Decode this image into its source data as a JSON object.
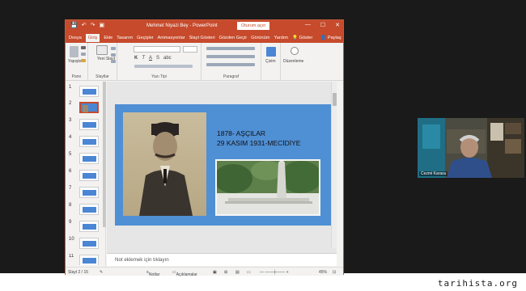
{
  "window": {
    "title": "Mehmet Niyazi Bey - PowerPoint",
    "signin": "Oturum açın",
    "controls": {
      "minimize": "—",
      "maximize": "☐",
      "close": "✕"
    }
  },
  "ribbon_tabs": [
    "Dosya",
    "Giriş",
    "Ekle",
    "Tasarım",
    "Geçişler",
    "Animasyonlar",
    "Slayt Gösteri",
    "Gözden Geçir",
    "Görünüm",
    "Yardım"
  ],
  "ribbon_right": {
    "tellme": "Göster",
    "share": "Paylaş"
  },
  "ribbon_groups": {
    "clipboard": {
      "label": "Pano",
      "paste": "Yapıştır"
    },
    "slides": {
      "label": "Slaytlar",
      "new_slide": "Yeni Slayt"
    },
    "font": {
      "label": "Yazı Tipi",
      "bold": "K",
      "italic": "T",
      "underline": "A",
      "strike": "S",
      "shadow": "abc"
    },
    "paragraph": {
      "label": "Paragraf"
    },
    "drawing": {
      "label": "Çizim"
    },
    "editing": {
      "label": "Düzenleme"
    }
  },
  "thumbnails": [
    "1",
    "2",
    "3",
    "4",
    "5",
    "6",
    "7",
    "8",
    "9",
    "10",
    "11"
  ],
  "selected_thumbnail": "2",
  "slide": {
    "line1": "1878- AŞÇILAR",
    "line2": "29 KASIM 1931-MECİDİYE"
  },
  "notes_placeholder": "Not eklemek için tıklayın",
  "status": {
    "slide_count": "Slayt 2 / 15",
    "notes": "Notlar",
    "comments": "Açıklamalar",
    "zoom": "45%"
  },
  "video": {
    "participant": "Cezmi Karasu"
  },
  "watermark": "tarihista.org"
}
